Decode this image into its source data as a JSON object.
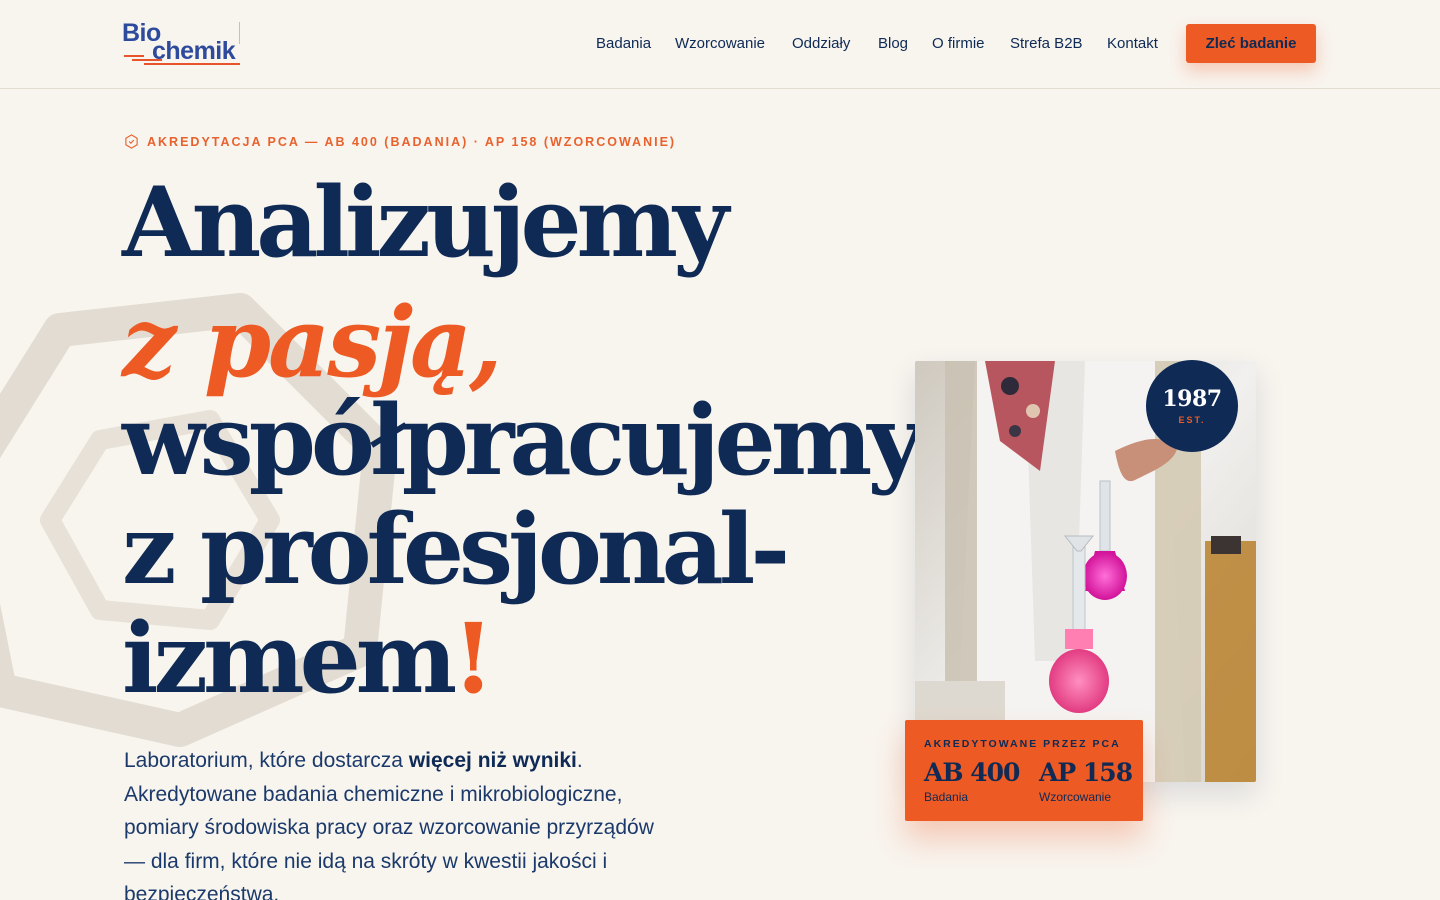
{
  "logo": {
    "line1": "Bio",
    "line2": "chemik"
  },
  "nav": {
    "items": [
      "Badania",
      "Wzorcowanie",
      "Oddziały",
      "Blog",
      "O firmie",
      "Strefa B2B",
      "Kontakt"
    ],
    "cta": "Zleć badanie"
  },
  "hero": {
    "accreditation": "AKREDYTACJA PCA — AB 400 (BADANIA) · AP 158 (WZORCOWANIE)",
    "headline": {
      "line1": "Analizujemy",
      "line2": "z pasją,",
      "line3": "współpracujemy",
      "line4": "z profesjonal-",
      "line5": "izmem",
      "exclaim": "!"
    },
    "intro": {
      "part1": "Laboratorium, które dostarcza ",
      "bold": "więcej niż wyniki",
      "part2": ". Akredytowane badania chemiczne i mikrobiologiczne, pomiary środowiska pracy oraz wzorcowanie przyrządów — dla firm, które nie idą na skróty w kwestii jakości i bezpieczeństwa."
    }
  },
  "est": {
    "year": "1987",
    "label": "EST."
  },
  "badge": {
    "title": "AKREDYTOWANE PRZEZ PCA",
    "items": [
      {
        "code": "AB 400",
        "label": "Badania"
      },
      {
        "code": "AP 158",
        "label": "Wzorcowanie"
      }
    ]
  },
  "colors": {
    "navy": "#0e2a55",
    "orange": "#ee5a23",
    "background": "#f8f4ee"
  }
}
